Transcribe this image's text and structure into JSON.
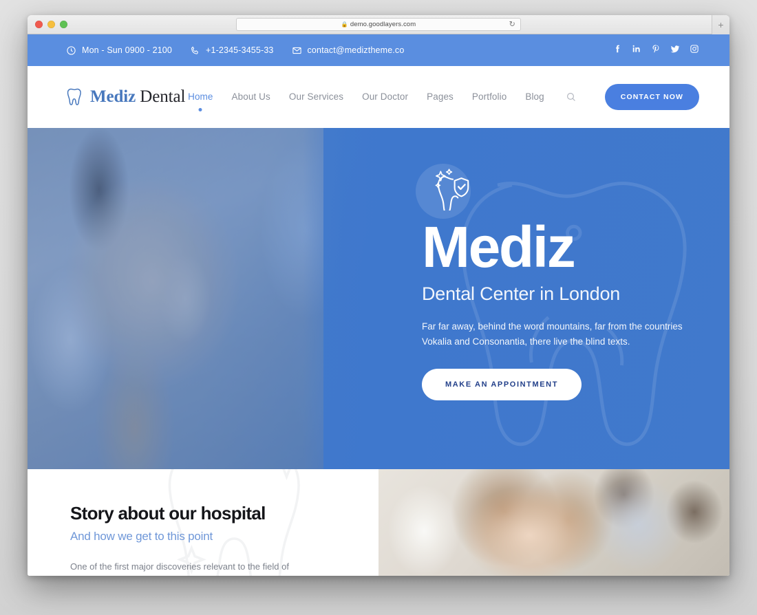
{
  "browser": {
    "url": "demo.goodlayers.com",
    "lock_icon": "lock-icon",
    "reload_icon": "reload-icon",
    "newtab_label": "+",
    "traffic_lights": [
      "close-red",
      "minimize-yellow",
      "maximize-green"
    ]
  },
  "topbar": {
    "hours": "Mon - Sun 0900 - 2100",
    "phone": "+1-2345-3455-33",
    "email": "contact@mediztheme.co",
    "background_color": "#5a8ee0",
    "social": [
      {
        "name": "facebook",
        "label": "f"
      },
      {
        "name": "linkedin",
        "label": "in"
      },
      {
        "name": "pinterest",
        "label": "P"
      },
      {
        "name": "twitter",
        "label": "t"
      },
      {
        "name": "instagram",
        "label": "ig"
      }
    ]
  },
  "header": {
    "logo_primary": "Mediz",
    "logo_secondary": "Dental",
    "logo_icon": "tooth-icon",
    "nav": [
      {
        "label": "Home",
        "active": true
      },
      {
        "label": "About Us",
        "active": false
      },
      {
        "label": "Our Services",
        "active": false
      },
      {
        "label": "Our Doctor",
        "active": false
      },
      {
        "label": "Pages",
        "active": false
      },
      {
        "label": "Portfolio",
        "active": false
      },
      {
        "label": "Blog",
        "active": false
      }
    ],
    "search_icon": "search-icon",
    "cta_label": "CONTACT NOW",
    "accent_color": "#4a7fe0",
    "nav_active_color": "#5b8de0"
  },
  "hero": {
    "title": "Mediz",
    "subtitle": "Dental Center in London",
    "description": "Far far away, behind the word mountains, far from the countries Vokalia and Consonantia, there live the blind texts.",
    "cta_label": "MAKE AN APPOINTMENT",
    "badge_icon": "tooth-shield-sparkle-icon",
    "background_color": "#3f78cd",
    "photo_alt": "dentist-examining-patient-photo"
  },
  "story": {
    "title": "Story about our hospital",
    "subtitle": "And how we get to this point",
    "body": "One of the first major discoveries relevant to the field of",
    "subtitle_color": "#6f97d8",
    "watermark_icon": "tooth-sparkle-watermark",
    "photo_alt": "smiling-woman-in-dental-clinic-photo"
  }
}
